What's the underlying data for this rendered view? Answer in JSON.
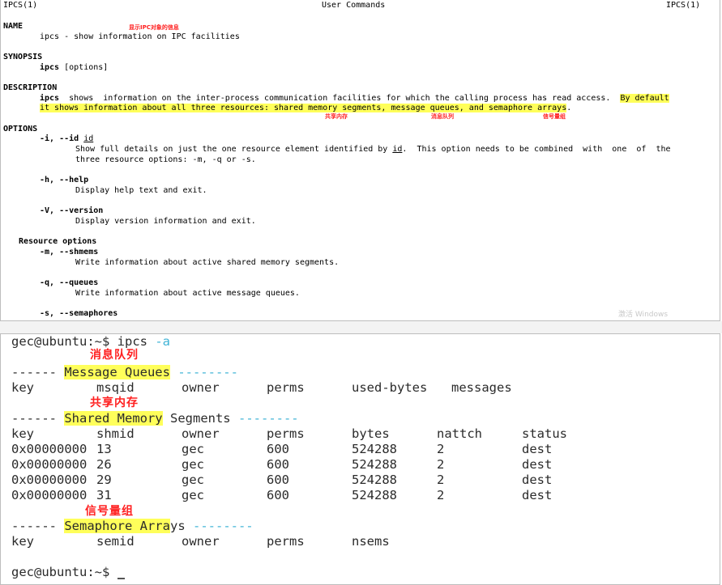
{
  "man": {
    "header_left": "IPCS(1)",
    "header_center": "User Commands",
    "header_right": "IPCS(1)",
    "name_heading": "NAME",
    "name_annotation": "显示IPC对象的信息",
    "name_line": "ipcs - show information on IPC facilities",
    "synopsis_heading": "SYNOPSIS",
    "synopsis_cmd": "ipcs",
    "synopsis_args": " [options]",
    "description_heading": "DESCRIPTION",
    "desc_cmd": "ipcs",
    "desc_line1_rest": "  shows  information on the inter-process communication facilities for which the calling process has read access.  ",
    "desc_line1_hl": "By default",
    "desc_line2_hl": "it shows information about all three resources: shared memory segments, message queues, and semaphore arrays",
    "desc_line2_end": ".",
    "ann_shm": "共享内存",
    "ann_msg": "消息队列",
    "ann_sem": "信号量组",
    "options_heading": "OPTIONS",
    "opt_i": "-i, --id ",
    "opt_i_arg": "id",
    "opt_i_desc1": "Show full details on just the one resource element identified by ",
    "opt_i_desc1_arg": "id",
    "opt_i_desc1_rest": ".  This option needs to be combined  with  one  of  the",
    "opt_i_desc2": "three resource options: -m, -q or -s.",
    "opt_h": "-h, --help",
    "opt_h_desc": "Display help text and exit.",
    "opt_V": "-V, --version",
    "opt_V_desc": "Display version information and exit.",
    "resource_heading": "Resource options",
    "opt_m": "-m, --shmems",
    "opt_m_desc": "Write information about active shared memory segments.",
    "opt_q": "-q, --queues",
    "opt_q_desc": "Write information about active message queues.",
    "opt_s": "-s, --semaphores",
    "watermark": "激活 Windows"
  },
  "terminal": {
    "prompt": "gec@ubuntu:~$ ",
    "command": "ipcs",
    "flag": " -a",
    "ann_msg": "消息队列",
    "ann_shm": "共享内存",
    "ann_sem": "信号量组",
    "mq_dashes": "------ ",
    "mq_title": "Message Queues",
    "mq_trail": " --------",
    "mq_columns": [
      "key",
      "msqid",
      "owner",
      "perms",
      "used-bytes",
      "messages"
    ],
    "shm_dashes": "------ ",
    "shm_title": "Shared Memory",
    "shm_title_rest": " Segments",
    "shm_trail": " --------",
    "shm_columns": [
      "key",
      "shmid",
      "owner",
      "perms",
      "bytes",
      "nattch",
      "status"
    ],
    "shm_rows": [
      [
        "0x00000000",
        "13",
        "gec",
        "600",
        "524288",
        "2",
        "dest"
      ],
      [
        "0x00000000",
        "26",
        "gec",
        "600",
        "524288",
        "2",
        "dest"
      ],
      [
        "0x00000000",
        "29",
        "gec",
        "600",
        "524288",
        "2",
        "dest"
      ],
      [
        "0x00000000",
        "31",
        "gec",
        "600",
        "524288",
        "2",
        "dest"
      ]
    ],
    "sem_dashes": "------ ",
    "sem_title": "Semaphore Arra",
    "sem_title_rest": "ys",
    "sem_trail": " --------",
    "sem_columns": [
      "key",
      "semid",
      "owner",
      "perms",
      "nsems"
    ],
    "final_prompt": "gec@ubuntu:~$ "
  }
}
